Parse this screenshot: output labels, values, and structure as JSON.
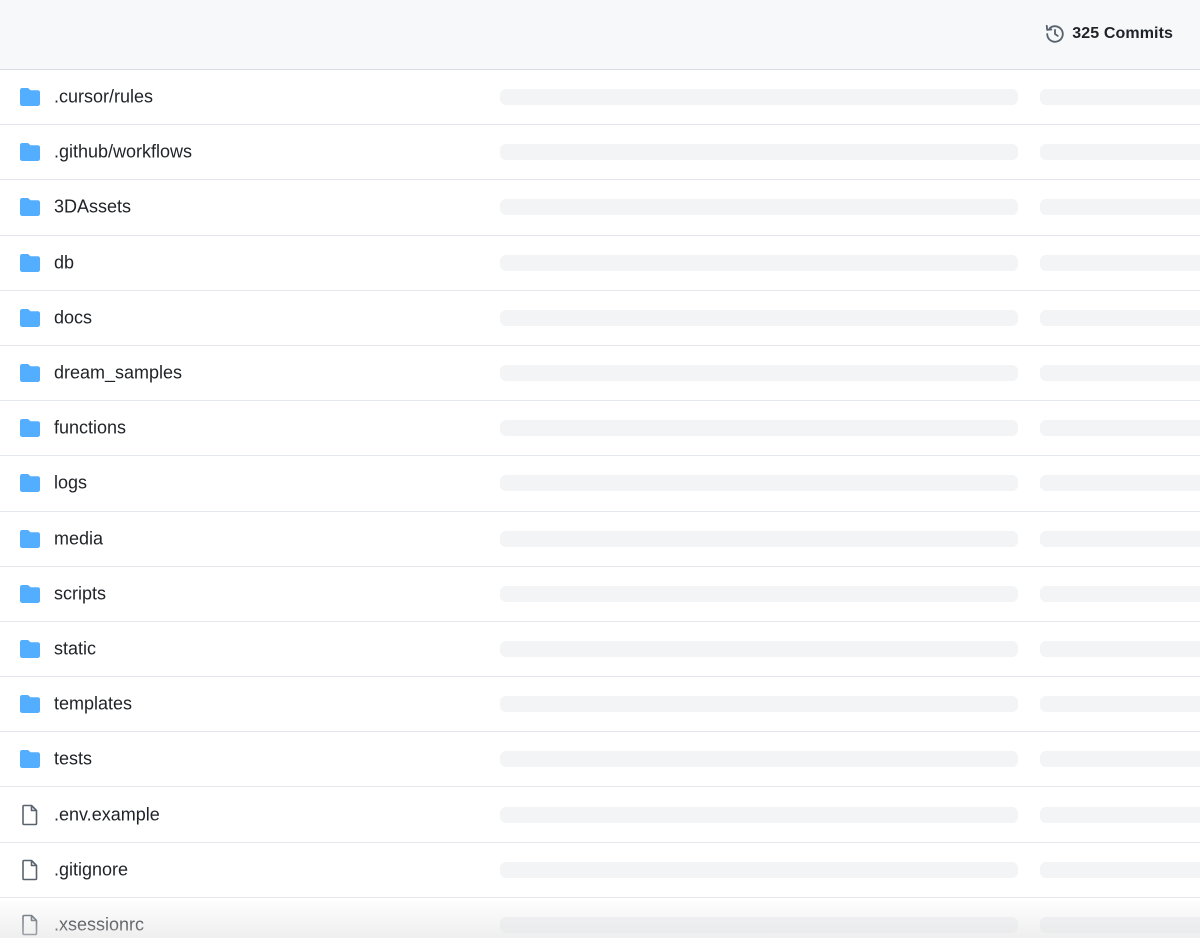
{
  "header": {
    "commits_label": "325 Commits"
  },
  "files": [
    {
      "name": ".cursor/rules",
      "type": "folder"
    },
    {
      "name": ".github/workflows",
      "type": "folder"
    },
    {
      "name": "3DAssets",
      "type": "folder"
    },
    {
      "name": "db",
      "type": "folder"
    },
    {
      "name": "docs",
      "type": "folder"
    },
    {
      "name": "dream_samples",
      "type": "folder"
    },
    {
      "name": "functions",
      "type": "folder"
    },
    {
      "name": "logs",
      "type": "folder"
    },
    {
      "name": "media",
      "type": "folder"
    },
    {
      "name": "scripts",
      "type": "folder"
    },
    {
      "name": "static",
      "type": "folder"
    },
    {
      "name": "templates",
      "type": "folder"
    },
    {
      "name": "tests",
      "type": "folder"
    },
    {
      "name": ".env.example",
      "type": "file"
    },
    {
      "name": ".gitignore",
      "type": "file"
    },
    {
      "name": ".xsessionrc",
      "type": "file"
    }
  ],
  "icons": {
    "folder": "folder-icon",
    "file": "file-icon",
    "history": "history-icon"
  },
  "colors": {
    "folder": "#54aeff",
    "file_outline": "#59636e",
    "header_bg": "#f6f8fa",
    "skeleton": "#f3f4f6"
  }
}
